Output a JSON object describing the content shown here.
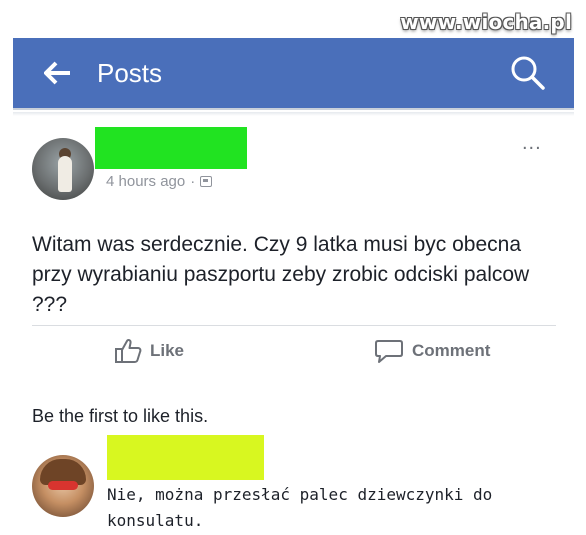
{
  "watermark": "www.wiocha.pl",
  "header": {
    "title": "Posts",
    "back_icon": "arrow-left-icon",
    "search_icon": "search-icon",
    "background_color": "#4a6fba"
  },
  "post": {
    "timestamp": "4 hours ago",
    "separator": "·",
    "privacy_icon": "friends-icon",
    "more_label": "...",
    "text": "Witam was serdecznie. Czy 9 latka musi byc obecna przy wyrabianiu paszportu zeby zrobic odciski palcow ???",
    "author_redaction_color": "#21e321"
  },
  "actions": {
    "like_label": "Like",
    "like_icon": "thumbs-up-icon",
    "comment_label": "Comment",
    "comment_icon": "comment-bubble-icon"
  },
  "likes_summary": "Be the first to like this.",
  "comment": {
    "text": "Nie, można przesłać palec dziewczynki do konsulatu.",
    "commenter_redaction_color": "#d8f720"
  }
}
